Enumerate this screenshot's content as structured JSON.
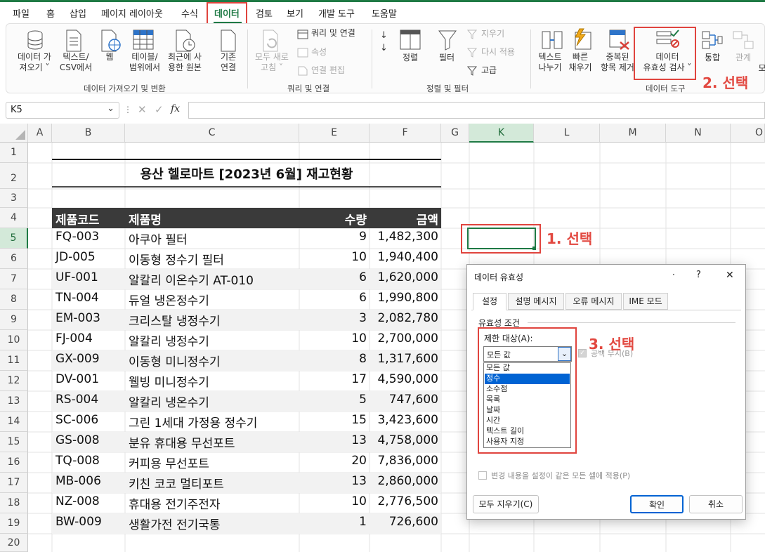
{
  "menu": {
    "tabs": [
      "파일",
      "홈",
      "삽입",
      "페이지 레이아웃",
      "수식",
      "데이터",
      "검토",
      "보기",
      "개발 도구",
      "도움말"
    ],
    "active": "데이터"
  },
  "ribbon": {
    "get_data": "데이터 가\n져오기 ˅",
    "text_csv": "텍스트/\nCSV에서",
    "web": "웹",
    "table_range": "테이블/\n범위에서",
    "recent_sources": "최근에 사\n용한 원본",
    "existing_conn": "기존\n연결",
    "group_get_transform": "데이터 가져오기 및 변환",
    "refresh_all": "모두 새로\n고침 ˅",
    "queries_conn": "쿼리 및 연결",
    "properties": "속성",
    "edit_links": "연결 편집",
    "group_queries": "쿼리 및 연결",
    "sort": "정렬",
    "filter": "필터",
    "clear": "지우기",
    "reapply": "다시 적용",
    "advanced": "고급",
    "group_sort_filter": "정렬 및 필터",
    "text_to_columns": "텍스트\n나누기",
    "flash_fill": "빠른\n채우기",
    "remove_dup": "중복된\n항목 제거",
    "data_validation": "데이터\n유효성 검사 ˅",
    "group_data_tools": "데이터 도구",
    "consolidate": "통합",
    "relationships": "관계",
    "more": "모"
  },
  "formula_bar": {
    "name_box": "K5",
    "fx": "fx",
    "formula": ""
  },
  "sheet": {
    "columns": [
      "A",
      "B",
      "C",
      "E",
      "F",
      "G",
      "K",
      "L",
      "M",
      "N",
      "O"
    ],
    "rows": [
      "1",
      "2",
      "3",
      "4",
      "5",
      "6",
      "7",
      "8",
      "9",
      "10",
      "11",
      "12",
      "13",
      "14",
      "15",
      "16",
      "17",
      "18",
      "19",
      "20"
    ],
    "title": "용산 헬로마트 [2023년 6월] 재고현황",
    "headers": {
      "code": "제품코드",
      "name": "제품명",
      "qty": "수량",
      "amount": "금액"
    },
    "items": [
      {
        "code": "FQ-003",
        "name": "아쿠아 필터",
        "qty": "9",
        "amount": "1,482,300"
      },
      {
        "code": "JD-005",
        "name": "이동형 정수기 필터",
        "qty": "10",
        "amount": "1,940,400"
      },
      {
        "code": "UF-001",
        "name": "알칼리 이온수기 AT-010",
        "qty": "6",
        "amount": "1,620,000"
      },
      {
        "code": "TN-004",
        "name": "듀얼 냉온정수기",
        "qty": "6",
        "amount": "1,990,800"
      },
      {
        "code": "EM-003",
        "name": "크리스탈 냉정수기",
        "qty": "3",
        "amount": "2,082,780"
      },
      {
        "code": "FJ-004",
        "name": "알칼리 냉정수기",
        "qty": "10",
        "amount": "2,700,000"
      },
      {
        "code": "GX-009",
        "name": "이동형 미니정수기",
        "qty": "8",
        "amount": "1,317,600"
      },
      {
        "code": "DV-001",
        "name": "웰빙 미니정수기",
        "qty": "17",
        "amount": "4,590,000"
      },
      {
        "code": "RS-004",
        "name": "알칼리 냉온수기",
        "qty": "5",
        "amount": "747,600"
      },
      {
        "code": "SC-006",
        "name": "그린 1세대 가정용 정수기",
        "qty": "15",
        "amount": "3,423,600"
      },
      {
        "code": "GS-008",
        "name": "분유 휴대용 무선포트",
        "qty": "13",
        "amount": "4,758,000"
      },
      {
        "code": "TQ-008",
        "name": "커피용 무선포트",
        "qty": "20",
        "amount": "7,836,000"
      },
      {
        "code": "MB-006",
        "name": "키친 코코 멀티포트",
        "qty": "13",
        "amount": "2,860,000"
      },
      {
        "code": "NZ-008",
        "name": "휴대용 전기주전자",
        "qty": "10",
        "amount": "2,776,500"
      },
      {
        "code": "BW-009",
        "name": "생활가전 전기국통",
        "qty": "1",
        "amount": "726,600"
      }
    ]
  },
  "annotations": {
    "step1": "1. 선택",
    "step2": "2. 선택",
    "step3": "3. 선택"
  },
  "dialog": {
    "title": "데이터 유효성",
    "dot": "·",
    "help": "?",
    "close": "✕",
    "tabs": [
      "설정",
      "설명 메시지",
      "오류 메시지",
      "IME 모드"
    ],
    "section": "유효성 조건",
    "allow_label": "제한 대상(A):",
    "allow_value": "모든 값",
    "ignore_blank": "공백 무시(B)",
    "options": [
      "모든 값",
      "정수",
      "소수점",
      "목록",
      "날짜",
      "시간",
      "텍스트 길이",
      "사용자 지정"
    ],
    "highlighted": "정수",
    "apply_all": "변경 내용을 설정이 같은 모든 셀에 적용(P)",
    "clear_all": "모두 지우기(C)",
    "ok": "확인",
    "cancel": "취소"
  },
  "colors": {
    "accent": "#1f7a45",
    "annotation": "#e24840",
    "header_band": "#3a3a3a",
    "selection": "#0063d3"
  }
}
